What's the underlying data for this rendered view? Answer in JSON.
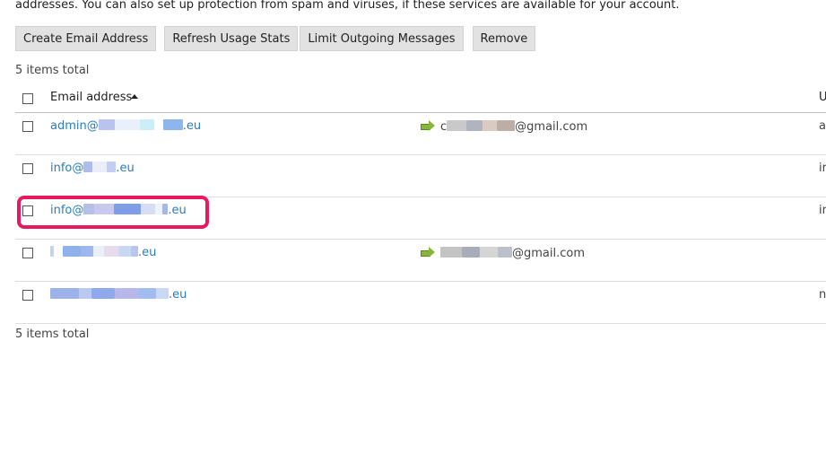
{
  "intro_text": "addresses. You can also set up protection from spam and viruses, if these services are available for your account.",
  "toolbar": {
    "create_label": "Create Email Address",
    "refresh_label": "Refresh Usage Stats",
    "limit_label": "Limit Outgoing Messages",
    "remove_label": "Remove"
  },
  "items_total_top": "5 items total",
  "items_total_bottom": "5 items total",
  "table": {
    "header_email": "Email address",
    "header_col_u": "U"
  },
  "rows": [
    {
      "email_prefix": "admin@",
      "email_suffix": ".eu",
      "forward_prefix": "c",
      "forward_suffix": "@gmail.com",
      "col_u": "a"
    },
    {
      "email_prefix": "info@",
      "email_suffix": ".eu",
      "forward_prefix": "",
      "forward_suffix": "",
      "col_u": "ir"
    },
    {
      "email_prefix": "info@",
      "email_suffix": ".eu",
      "forward_prefix": "",
      "forward_suffix": "",
      "col_u": "ir"
    },
    {
      "email_prefix": "",
      "email_suffix": ".eu",
      "forward_prefix": "",
      "forward_suffix": "@gmail.com",
      "col_u": ""
    },
    {
      "email_prefix": "",
      "email_suffix": ".eu",
      "forward_prefix": "",
      "forward_suffix": "",
      "col_u": "n"
    }
  ],
  "colors": {
    "link": "#2a7cbd",
    "highlight": "#e8185c",
    "forward_icon": "#86b63a"
  },
  "icons": {
    "sort": "sort-ascending-icon",
    "forward": "forward-arrow-icon"
  }
}
